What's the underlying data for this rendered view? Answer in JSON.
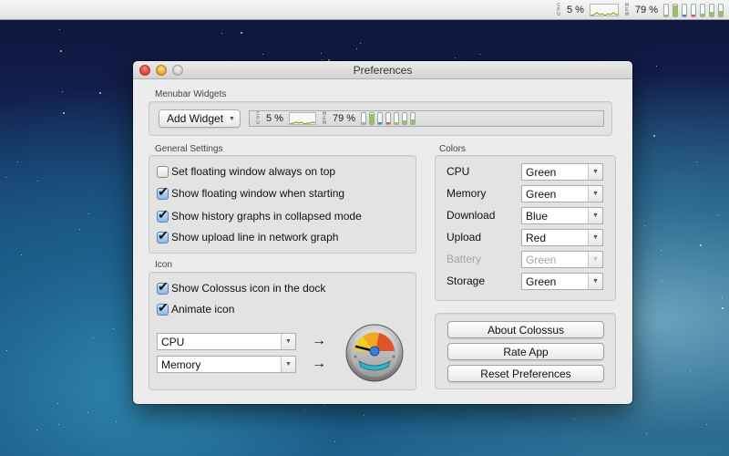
{
  "menubar": {
    "cpu_label": "CPU",
    "cpu_value": "5 %",
    "mem_label": "MEM",
    "mem_value": "79 %",
    "bar_fills": [
      {
        "color": "#9ac25a",
        "level": 0.15
      },
      {
        "color": "#9ac25a",
        "level": 0.9
      },
      {
        "color": "#4f7ec4",
        "level": 0.15
      },
      {
        "color": "#d9534f",
        "level": 0.15
      },
      {
        "color": "#9ac25a",
        "level": 0.2
      },
      {
        "color": "#9ac25a",
        "level": 0.35
      },
      {
        "color": "#9ac25a",
        "level": 0.45
      }
    ]
  },
  "window": {
    "title": "Preferences"
  },
  "menubar_widgets": {
    "section_label": "Menubar Widgets",
    "add_widget_label": "Add Widget",
    "preview_cpu_value": "5 %",
    "preview_mem_value": "79 %"
  },
  "general_settings": {
    "section_label": "General Settings",
    "options": [
      {
        "label": "Set floating window always on top",
        "checked": false
      },
      {
        "label": "Show floating window when starting",
        "checked": true
      },
      {
        "label": "Show history graphs in collapsed mode",
        "checked": true
      },
      {
        "label": "Show upload line in network graph",
        "checked": true
      }
    ]
  },
  "icon": {
    "section_label": "Icon",
    "options": [
      {
        "label": "Show Colossus icon in the dock",
        "checked": true
      },
      {
        "label": "Animate icon",
        "checked": true
      }
    ],
    "gauge_source_1": "CPU",
    "gauge_source_2": "Memory",
    "arrow_glyph": "→"
  },
  "colors": {
    "section_label": "Colors",
    "rows": [
      {
        "label": "CPU",
        "value": "Green",
        "enabled": true
      },
      {
        "label": "Memory",
        "value": "Green",
        "enabled": true
      },
      {
        "label": "Download",
        "value": "Blue",
        "enabled": true
      },
      {
        "label": "Upload",
        "value": "Red",
        "enabled": true
      },
      {
        "label": "Battery",
        "value": "Green",
        "enabled": false
      },
      {
        "label": "Storage",
        "value": "Green",
        "enabled": true
      }
    ]
  },
  "actions": {
    "about_label": "About Colossus",
    "rate_label": "Rate App",
    "reset_label": "Reset Preferences"
  },
  "glyphs": {
    "checkmark": "✔",
    "dropdown": "▼"
  }
}
